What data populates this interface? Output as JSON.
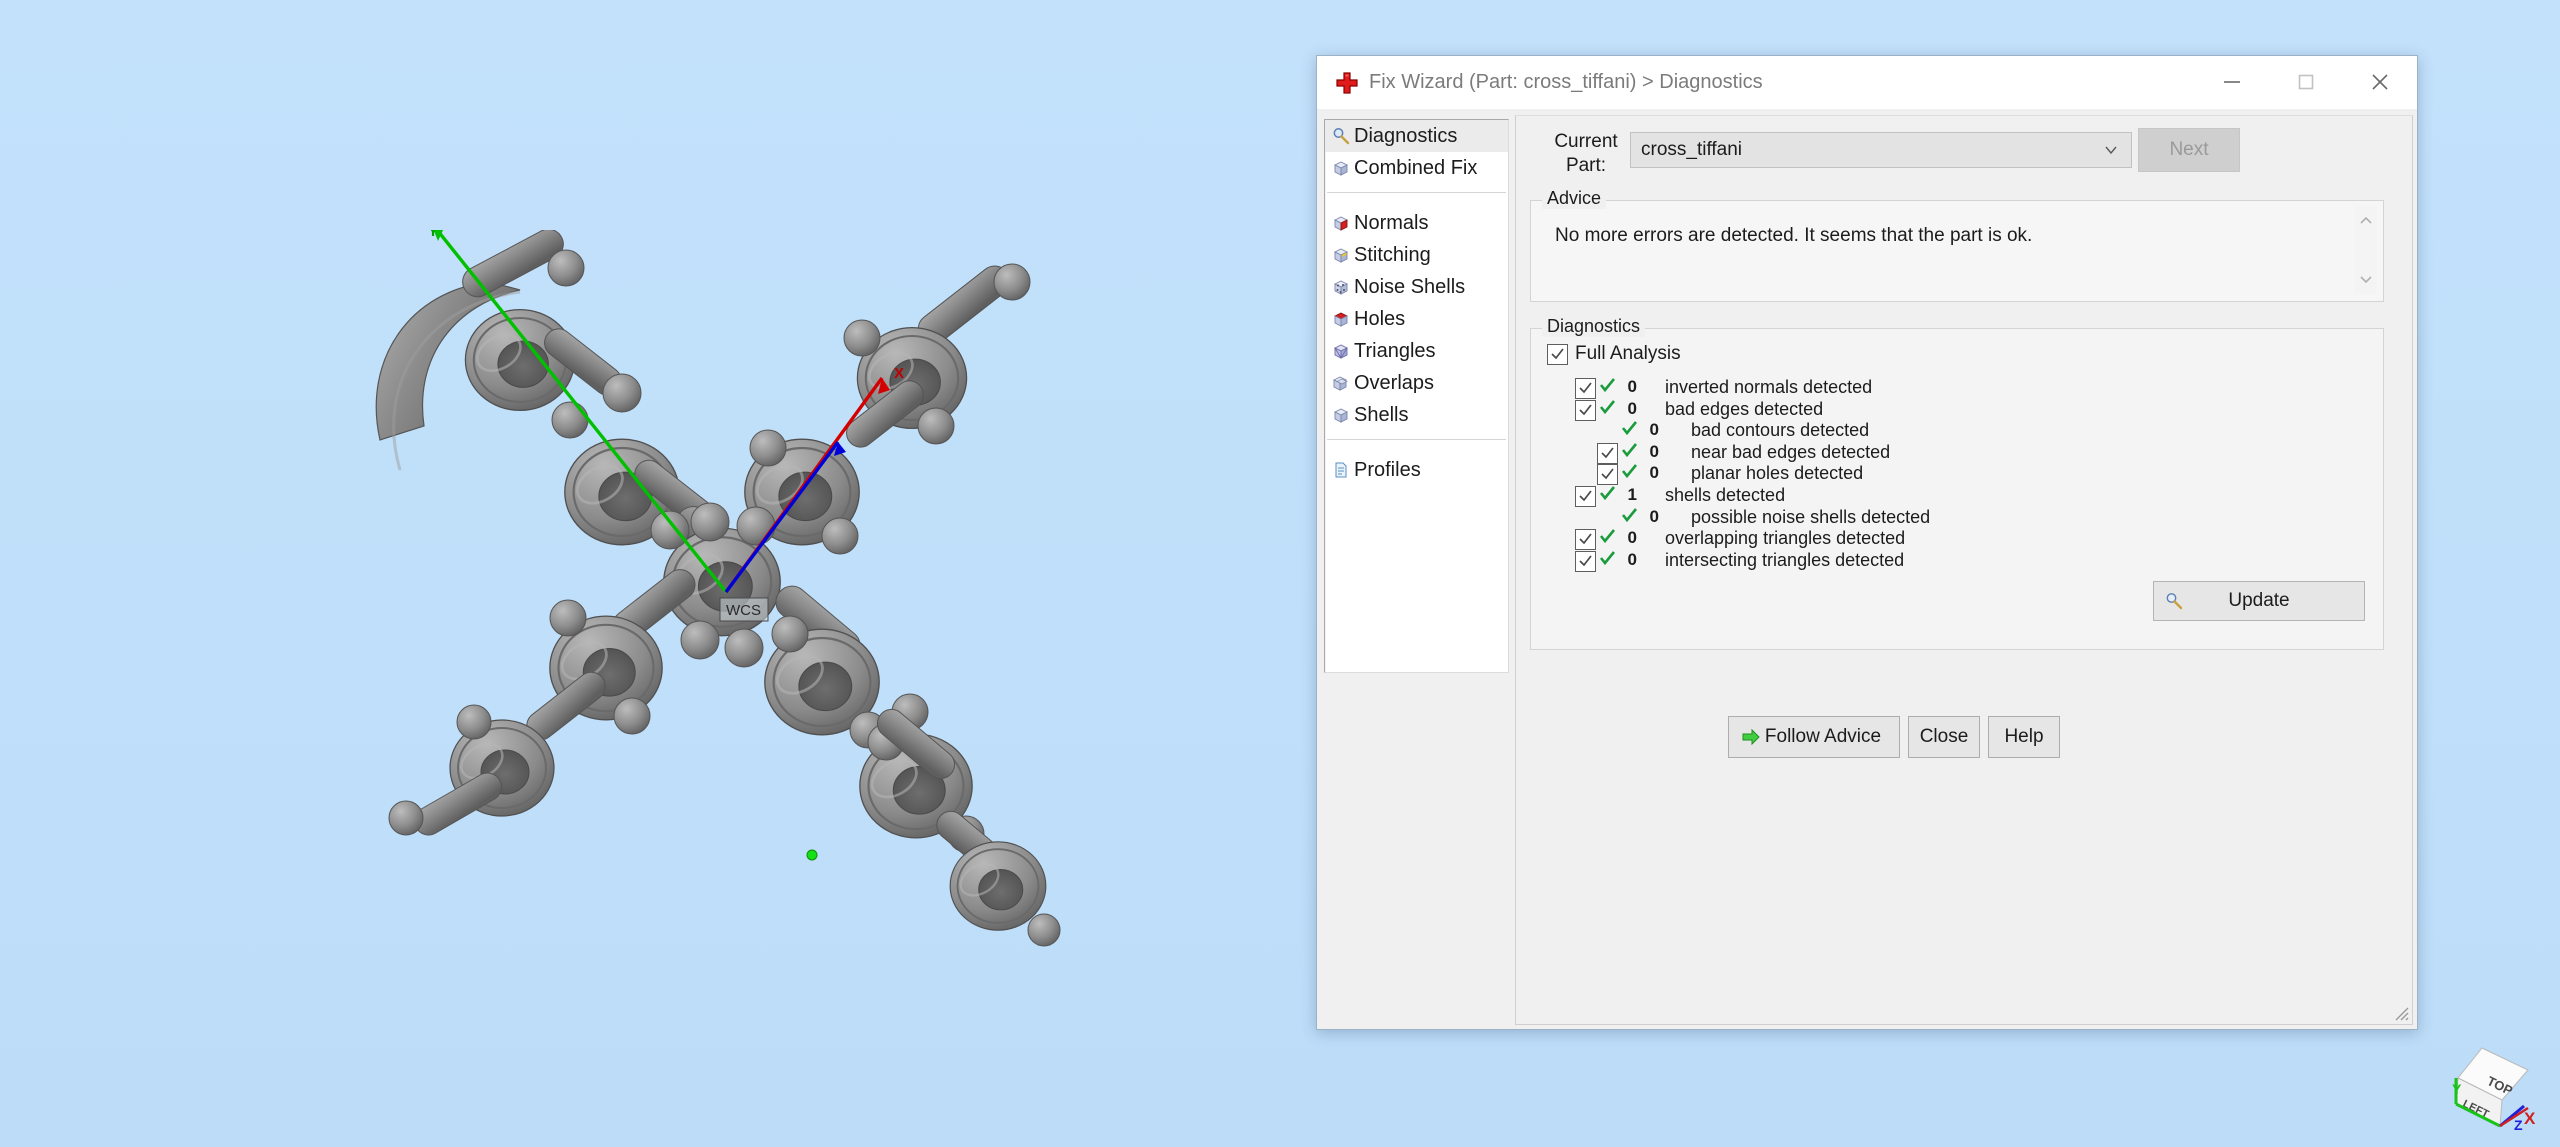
{
  "window": {
    "title": "Fix Wizard (Part: cross_tiffani) > Diagnostics",
    "app_icon": "red-cross-icon",
    "controls": {
      "minimize": "minimize-icon",
      "maximize": "maximize-icon",
      "close": "close-icon"
    }
  },
  "sidebar": {
    "groups": [
      {
        "items": [
          {
            "label": "Diagnostics",
            "icon": "magnifier-icon",
            "selected": true
          },
          {
            "label": "Combined Fix",
            "icon": "cube-icon",
            "selected": false
          }
        ]
      },
      {
        "items": [
          {
            "label": "Normals",
            "icon": "cube-red-face-icon",
            "selected": false
          },
          {
            "label": "Stitching",
            "icon": "cube-yellow-seam-icon",
            "selected": false
          },
          {
            "label": "Noise Shells",
            "icon": "noise-cube-icon",
            "selected": false
          },
          {
            "label": "Holes",
            "icon": "cube-red-hole-icon",
            "selected": false
          },
          {
            "label": "Triangles",
            "icon": "cube-triangles-icon",
            "selected": false
          },
          {
            "label": "Overlaps",
            "icon": "cube-overlap-icon",
            "selected": false
          },
          {
            "label": "Shells",
            "icon": "cube-shell-icon",
            "selected": false
          }
        ]
      },
      {
        "items": [
          {
            "label": "Profiles",
            "icon": "document-icon",
            "selected": false
          }
        ]
      }
    ]
  },
  "current_part": {
    "label_line1": "Current",
    "label_line2": "Part:",
    "value": "cross_tiffani",
    "next_label": "Next",
    "next_enabled": false
  },
  "advice": {
    "legend": "Advice",
    "text": "No more errors are detected. It seems that the part is ok."
  },
  "diagnostics": {
    "legend": "Diagnostics",
    "full_analysis_label": "Full Analysis",
    "full_analysis_checked": true,
    "rows": [
      {
        "label": "inverted normals detected",
        "count": "0",
        "checkbox": true,
        "checked": true,
        "status": "ok",
        "indent": 0
      },
      {
        "label": "bad edges detected",
        "count": "0",
        "checkbox": true,
        "checked": true,
        "status": "ok",
        "indent": 0
      },
      {
        "label": "bad contours detected",
        "count": "0",
        "checkbox": false,
        "checked": false,
        "status": "ok",
        "indent": 1
      },
      {
        "label": "near bad edges detected",
        "count": "0",
        "checkbox": true,
        "checked": true,
        "status": "ok",
        "indent": 1
      },
      {
        "label": "planar holes detected",
        "count": "0",
        "checkbox": true,
        "checked": true,
        "status": "ok",
        "indent": 1
      },
      {
        "label": "shells detected",
        "count": "1",
        "checkbox": true,
        "checked": true,
        "status": "ok",
        "indent": 0
      },
      {
        "label": "possible noise shells detected",
        "count": "0",
        "checkbox": false,
        "checked": false,
        "status": "ok",
        "indent": 1
      },
      {
        "label": "overlapping triangles detected",
        "count": "0",
        "checkbox": true,
        "checked": true,
        "status": "ok",
        "indent": 0
      },
      {
        "label": "intersecting triangles detected",
        "count": "0",
        "checkbox": true,
        "checked": true,
        "status": "ok",
        "indent": 0
      }
    ],
    "update_label": "Update",
    "update_icon": "magnifier-icon"
  },
  "footer": {
    "follow_advice_label": "Follow Advice",
    "follow_advice_icon": "green-arrow-icon",
    "close_label": "Close",
    "help_label": "Help",
    "resize_grip": "resize-grip-icon"
  },
  "viewport": {
    "background_color": "#bfdffa",
    "model_color": "#8a8a8a",
    "wcs_label": "WCS",
    "axes": [
      {
        "name": "X",
        "color": "#e00000"
      },
      {
        "name": "Y",
        "color": "#00c000"
      },
      {
        "name": "Z",
        "color": "#0000e0"
      }
    ],
    "view_cube": {
      "top_face": "TOP",
      "left_face": "LEFT",
      "x_label": "X",
      "y_label": "Y",
      "z_label": "Z"
    }
  }
}
